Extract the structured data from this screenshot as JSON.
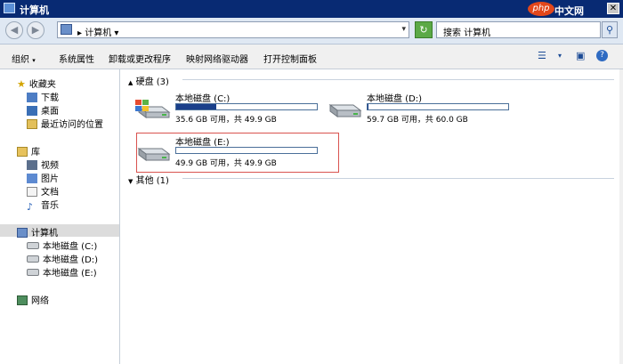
{
  "window": {
    "title": "计算机",
    "close_glyph": "✕"
  },
  "watermark": {
    "php": "php",
    "text": "中文网"
  },
  "address": {
    "path": "计算机",
    "separator": "▸",
    "dropdown": "▾",
    "refresh_glyph": "↻"
  },
  "search": {
    "text": "搜索 计算机",
    "icon": "⚲"
  },
  "nav_buttons": {
    "back": "◀",
    "forward": "▶"
  },
  "toolbar": {
    "items": [
      "组织",
      "系统属性",
      "卸载或更改程序",
      "映射网络驱动器",
      "打开控制面板"
    ],
    "dropdown_arrow": "▾",
    "view_icon": "☰",
    "pane_icon": "▣",
    "help_icon": "?"
  },
  "sidebar": {
    "favorites": {
      "label": "收藏夹",
      "items": [
        "下载",
        "桌面",
        "最近访问的位置"
      ]
    },
    "libraries": {
      "label": "库",
      "items": [
        "视频",
        "图片",
        "文档",
        "音乐"
      ]
    },
    "computer": {
      "label": "计算机",
      "items": [
        "本地磁盘 (C:)",
        "本地磁盘 (D:)",
        "本地磁盘 (E:)"
      ]
    },
    "network": {
      "label": "网络"
    }
  },
  "main": {
    "hard_disks_header": "硬盘 (3)",
    "other_header": "其他 (1)",
    "drives": [
      {
        "name": "本地磁盘 (C:)",
        "info": "35.6 GB 可用，共 49.9 GB",
        "used_fraction": 0.287
      },
      {
        "name": "本地磁盘 (D:)",
        "info": "59.7 GB 可用，共 60.0 GB",
        "used_fraction": 0.005
      },
      {
        "name": "本地磁盘 (E:)",
        "info": "49.9 GB 可用，共 49.9 GB",
        "used_fraction": 0.0
      }
    ]
  }
}
